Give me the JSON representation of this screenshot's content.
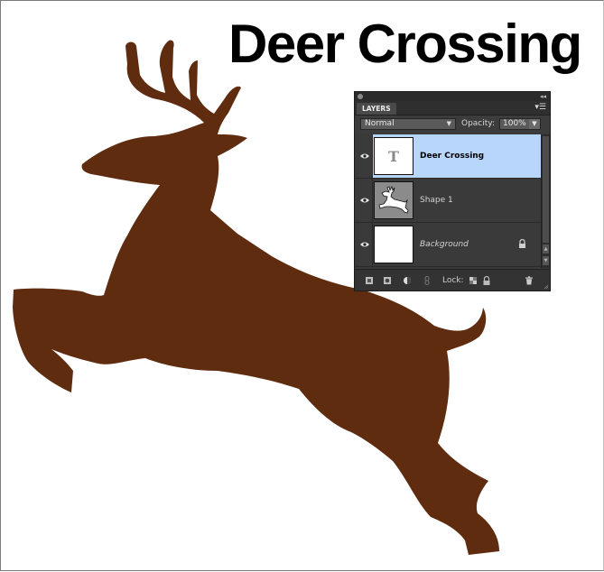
{
  "document": {
    "headline": "Deer Crossing"
  },
  "colors": {
    "deer": "#5f2c10",
    "selected_row": "#b8d6fc",
    "panel_bg": "#3a3a3a"
  },
  "layers_panel": {
    "tab_label": "LAYERS",
    "menu_icon": "panel-menu-icon",
    "blend_mode": "Normal",
    "opacity_label": "Opacity:",
    "opacity_value": "100%",
    "layers": [
      {
        "name": "Deer Crossing",
        "type": "text",
        "thumb_glyph": "T",
        "selected": true,
        "visible": true
      },
      {
        "name": "Shape 1",
        "type": "shape",
        "selected": false,
        "visible": true
      },
      {
        "name": "Background",
        "type": "background",
        "selected": false,
        "visible": true,
        "locked": true
      }
    ],
    "footer": {
      "lock_label": "Lock:",
      "icons": [
        "new-layer-icon",
        "layer-mask-icon",
        "adjustment-layer-icon",
        "link-icon",
        "lock-transparent-icon",
        "lock-all-icon",
        "trash-icon"
      ]
    }
  }
}
